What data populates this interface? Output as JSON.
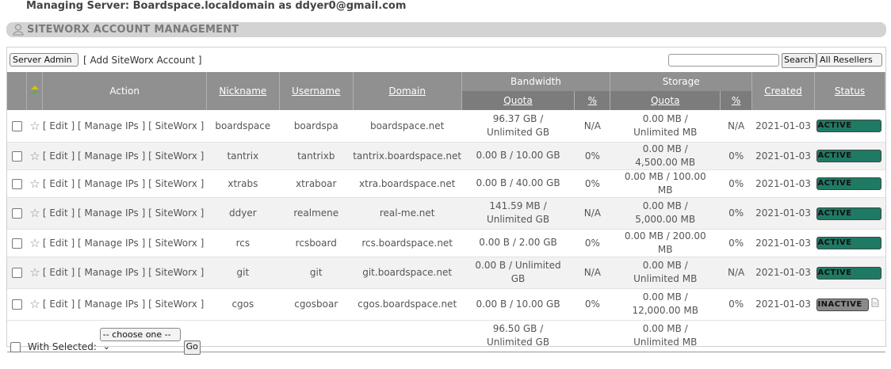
{
  "header": {
    "managing_text": "Managing Server: Boardspace.localdomain as ddyer0@gmail.com",
    "section_title": "SITEWORX ACCOUNT MANAGEMENT"
  },
  "toolbar": {
    "server_admin_select": "Server Admin",
    "add_account_link": "[ Add SiteWorx Account ]",
    "search_button": "Search",
    "resellers_select": "All Resellers"
  },
  "columns": {
    "action": "Action",
    "nickname": "Nickname",
    "username": "Username",
    "domain": "Domain",
    "bandwidth": "Bandwidth",
    "storage": "Storage",
    "quota": "Quota",
    "percent": "%",
    "created": "Created",
    "status": "Status"
  },
  "action_labels": {
    "edit": "[ Edit ]",
    "manage_ips": "[ Manage IPs ]",
    "siteworx": "[ SiteWorx ]"
  },
  "rows": [
    {
      "nickname": "boardspace",
      "username": "boardspa",
      "domain": "boardspace.net",
      "bw_quota": "96.37 GB / Unlimited GB",
      "bw_pct": "N/A",
      "st_quota": "0.00 MB / Unlimited MB",
      "st_pct": "N/A",
      "created": "2021-01-03",
      "status": "ACTIVE"
    },
    {
      "nickname": "tantrix",
      "username": "tantrixb",
      "domain": "tantrix.boardspace.net",
      "bw_quota": "0.00 B / 10.00 GB",
      "bw_pct": "0%",
      "st_quota": "0.00 MB / 4,500.00 MB",
      "st_pct": "0%",
      "created": "2021-01-03",
      "status": "ACTIVE"
    },
    {
      "nickname": "xtrabs",
      "username": "xtraboar",
      "domain": "xtra.boardspace.net",
      "bw_quota": "0.00 B / 40.00 GB",
      "bw_pct": "0%",
      "st_quota": "0.00 MB / 100.00 MB",
      "st_pct": "0%",
      "created": "2021-01-03",
      "status": "ACTIVE"
    },
    {
      "nickname": "ddyer",
      "username": "realmene",
      "domain": "real-me.net",
      "bw_quota": "141.59 MB / Unlimited GB",
      "bw_pct": "N/A",
      "st_quota": "0.00 MB / 5,000.00 MB",
      "st_pct": "0%",
      "created": "2021-01-03",
      "status": "ACTIVE"
    },
    {
      "nickname": "rcs",
      "username": "rcsboard",
      "domain": "rcs.boardspace.net",
      "bw_quota": "0.00 B / 2.00 GB",
      "bw_pct": "0%",
      "st_quota": "0.00 MB / 200.00 MB",
      "st_pct": "0%",
      "created": "2021-01-03",
      "status": "ACTIVE"
    },
    {
      "nickname": "git",
      "username": "git",
      "domain": "git.boardspace.net",
      "bw_quota": "0.00 B / Unlimited GB",
      "bw_pct": "N/A",
      "st_quota": "0.00 MB / Unlimited MB",
      "st_pct": "N/A",
      "created": "2021-01-03",
      "status": "ACTIVE"
    },
    {
      "nickname": "cgos",
      "username": "cgosboar",
      "domain": "cgos.boardspace.net",
      "bw_quota": "0.00 B / 10.00 GB",
      "bw_pct": "0%",
      "st_quota": "0.00 MB / 12,000.00 MB",
      "st_pct": "0%",
      "created": "2021-01-03",
      "status": "INACTIVE"
    }
  ],
  "totals": {
    "bandwidth": "96.50 GB / Unlimited GB",
    "storage": "0.00 MB / Unlimited MB"
  },
  "footer": {
    "with_selected": "With Selected:",
    "choose_select": "-- choose one --",
    "go_button": "Go"
  },
  "colors": {
    "active": "#1f7a64",
    "inactive": "#8a8a8a",
    "header": "#909090",
    "subheader": "#7c7c7c"
  }
}
